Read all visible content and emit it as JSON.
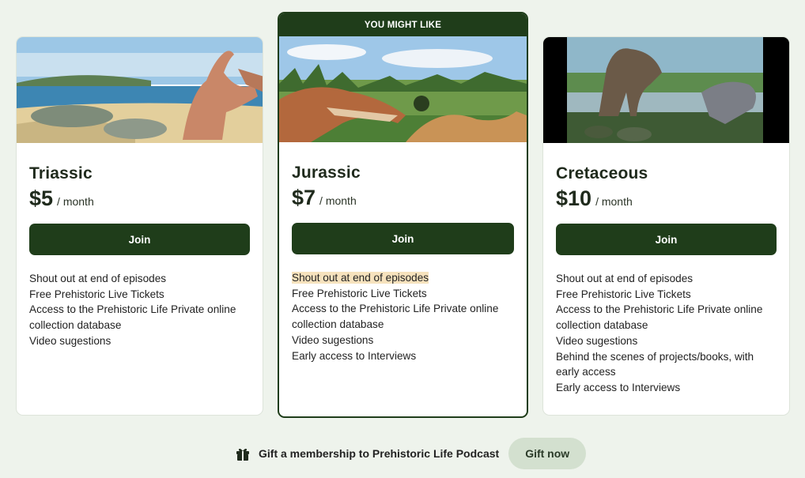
{
  "plans": [
    {
      "name": "Triassic",
      "price": "$5",
      "period": "/ month",
      "cta": "Join",
      "image": "triassic-dinosaurs-beach-image",
      "features": [
        "Shout out at end of episodes",
        "Free Prehistoric Live Tickets",
        "Access to the Prehistoric Life Private online collection database",
        "Video sugestions"
      ]
    },
    {
      "name": "Jurassic",
      "badge": "YOU MIGHT LIKE",
      "price": "$7",
      "period": "/ month",
      "cta": "Join",
      "image": "jurassic-dinosaurs-forest-image",
      "features": [
        "Shout out at end of episodes",
        "Free Prehistoric Live Tickets",
        "Access to the Prehistoric Life Private online collection database",
        "Video sugestions",
        "Early access to Interviews"
      ]
    },
    {
      "name": "Cretaceous",
      "price": "$10",
      "period": "/ month",
      "cta": "Join",
      "image": "cretaceous-dinosaurs-river-image",
      "features": [
        "Shout out at end of episodes",
        "Free Prehistoric Live Tickets",
        "Access to the Prehistoric Life Private online collection database",
        "Video sugestions",
        "Behind the scenes of projects/books, with early access",
        "Early access to Interviews"
      ]
    }
  ],
  "gift": {
    "icon": "gift-icon",
    "text": "Gift a membership to Prehistoric Life Podcast",
    "button": "Gift now"
  },
  "colors": {
    "background": "#eef3ec",
    "primary": "#1f3d1a",
    "highlight": "#f6e2bd",
    "gift_button": "#d3e0cf"
  }
}
